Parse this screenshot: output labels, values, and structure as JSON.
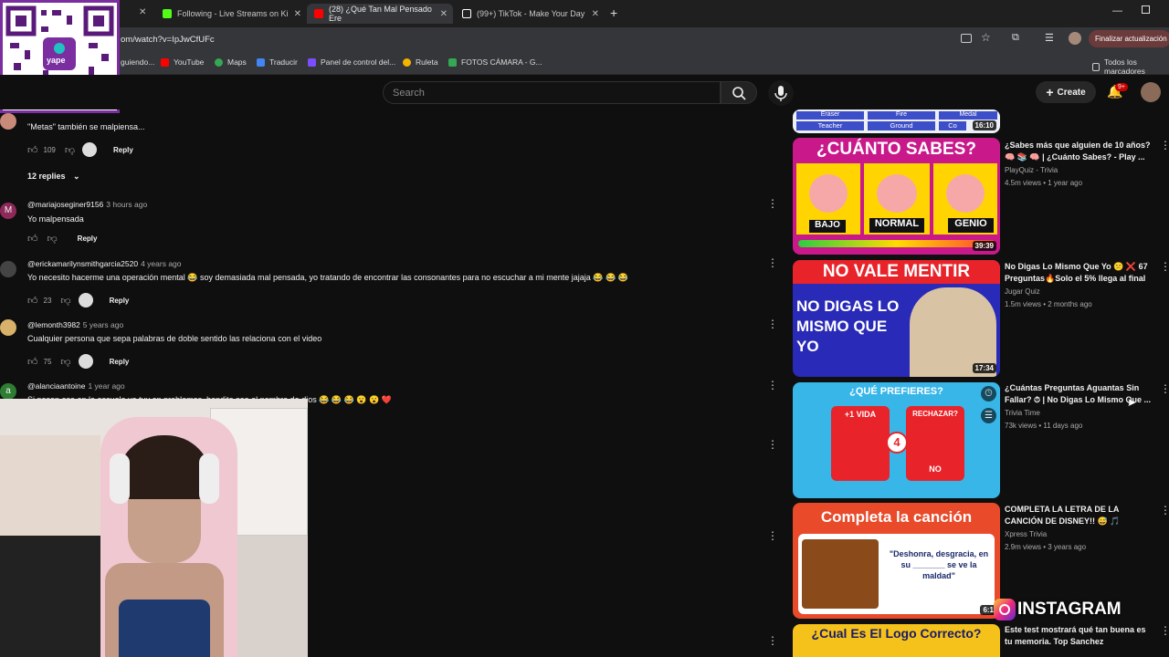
{
  "tabs": [
    {
      "label": "Following - Live Streams on Ki",
      "color": "#53fc18"
    },
    {
      "label": "(28) ¿Qué Tan Mal Pensado Ere",
      "color": "#ff0000"
    },
    {
      "label": "(99+) TikTok - Make Your Day",
      "color": "#111111"
    }
  ],
  "address": {
    "url": "om/watch?v=IpJwCfUFc",
    "update_label": "Finalizar actualización"
  },
  "bookmarks": [
    "guiendo...",
    "YouTube",
    "Maps",
    "Traducir",
    "Panel de control del...",
    "Ruleta",
    "FOTOS CÁMARA - G...",
    "Todos los marcadores"
  ],
  "qr": {
    "brand": "yape"
  },
  "header": {
    "search_placeholder": "Search",
    "create_label": "Create",
    "notif_count": "9+"
  },
  "comments": [
    {
      "author": "",
      "time": "",
      "text": "\"Metas\" también se malpiensa...",
      "likes": "109",
      "reply": "Reply"
    },
    {
      "author": "@mariajoseginer9156",
      "time": "3 hours ago",
      "text": "Yo malpensada",
      "likes": "",
      "reply": "Reply",
      "initial": "M"
    },
    {
      "author": "@erickamarilynsmithgarcia2520",
      "time": "4 years ago",
      "text": "Yo necesito hacerme una operación mental 😂 soy demasiada mal pensada, yo tratando de encontrar las consonantes para no escuchar a mi mente jajaja 😂 😂 😂",
      "likes": "23",
      "reply": "Reply"
    },
    {
      "author": "@lemonth3982",
      "time": "5 years ago",
      "text": "Cualquier persona que sepa palabras de doble sentido las relaciona con el video",
      "likes": "75",
      "reply": "Reply"
    },
    {
      "author": "@alanciaantoine",
      "time": "1 year ago",
      "text": "Si pasan eso en la escuela ya tuv en problemas, bendito sea el nombre de dios 😂 😂 😂 😮 😮 ❤️",
      "likes": "",
      "reply": "",
      "initial": "a"
    }
  ],
  "replies_toggle": "12 replies",
  "videos": [
    {
      "title": "",
      "channel": "",
      "meta": "",
      "duration": "16:10",
      "thumb_text": [
        "Eraser",
        "Fire",
        "Medal",
        "Teacher",
        "Ground",
        "Co"
      ]
    },
    {
      "title": "¿Sabes más que alguien de 10 años? 🧠 📚 🧠 | ¿Cuánto Sabes? - Play ...",
      "channel": "PlayQuiz - Trivia",
      "meta": "4.5m views • 1 year ago",
      "duration": "39:39",
      "thumb_text": [
        "¿CUÁNTO SABES?",
        "BAJO",
        "NORMAL",
        "GENIO"
      ]
    },
    {
      "title": "No Digas Lo Mismo Que Yo 😕 ❌ 67 Preguntas🔥Solo el 5% llega al final",
      "channel": "Jugar Quiz",
      "meta": "1.5m views • 2 months ago",
      "duration": "17:34",
      "thumb_text": [
        "NO VALE MENTIR",
        "NO DIGAS LO MISMO QUE YO"
      ]
    },
    {
      "title": "¿Cuántas Preguntas Aguantas Sin Fallar? ⏱ | No Digas Lo Mismo Que ...",
      "channel": "Trivia Time",
      "meta": "73k views • 11 days ago",
      "duration": "",
      "thumb_text": [
        "¿QUÉ PREFIERES?",
        "+1 VIDA",
        "RECHAZAR?",
        "4",
        "NO"
      ]
    },
    {
      "title": "COMPLETA LA LETRA DE LA CANCIÓN DE DISNEY!! 😅 🎵",
      "channel": "Xpress Trivia",
      "meta": "2.9m views • 3 years ago",
      "duration": "6:1",
      "thumb_text": [
        "Completa la canción",
        "\"Deshonra, desgracia, en su _______ se ve la maldad\""
      ]
    },
    {
      "title": "Este test mostrará qué tan buena es tu memoria. Top Sanchez",
      "channel": "",
      "meta": "",
      "duration": "",
      "thumb_text": [
        "¿Cual Es El Logo Correcto?"
      ]
    }
  ],
  "overlay": {
    "instagram": "INSTAGRAM"
  }
}
